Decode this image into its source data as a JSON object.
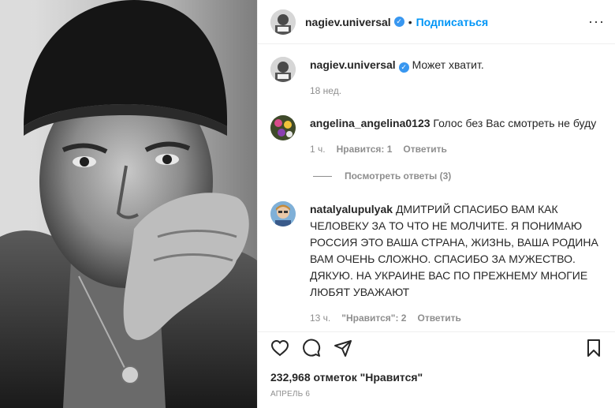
{
  "post": {
    "author": "nagiev.universal",
    "follow_label": "Подписаться",
    "separator": "•"
  },
  "caption": {
    "author": "nagiev.universal",
    "text": "Может хватит.",
    "time": "18 нед."
  },
  "comments": [
    {
      "author": "angelina_angelina0123",
      "text": "Голос без Вас смотреть не буду",
      "time": "1 ч.",
      "likes": "Нравится: 1",
      "reply": "Ответить"
    },
    {
      "author": "natalyalupulyak",
      "text": "ДМИТРИЙ СПАСИБО ВАМ КАК ЧЕЛОВЕКУ ЗА ТО ЧТО НЕ МОЛЧИТЕ. Я ПОНИМАЮ РОССИЯ ЭТО ВАША СТРАНА, ЖИЗНЬ, ВАША РОДИНА ВАМ ОЧЕНЬ СЛОЖНО. СПАСИБО ЗА МУЖЕСТВО. ДЯКУЮ. НА УКРАИНЕ ВАС ПО ПРЕЖНЕМУ МНОГИЕ ЛЮБЯТ УВАЖАЮТ",
      "time": "13 ч.",
      "likes": "\"Нравится\": 2",
      "reply": "Ответить"
    }
  ],
  "view_replies": "Посмотреть ответы (3)",
  "likes_line": "232,968 отметок \"Нравится\"",
  "date_line": "АПРЕЛЬ 6",
  "icons": {
    "like": "heart-icon",
    "comment": "comment-icon",
    "share": "share-icon",
    "save": "bookmark-icon",
    "more": "more-icon",
    "verified": "verified-icon"
  },
  "colors": {
    "follow": "#0095f6",
    "verified": "#3897f0",
    "muted": "#8e8e8e",
    "text": "#262626"
  }
}
